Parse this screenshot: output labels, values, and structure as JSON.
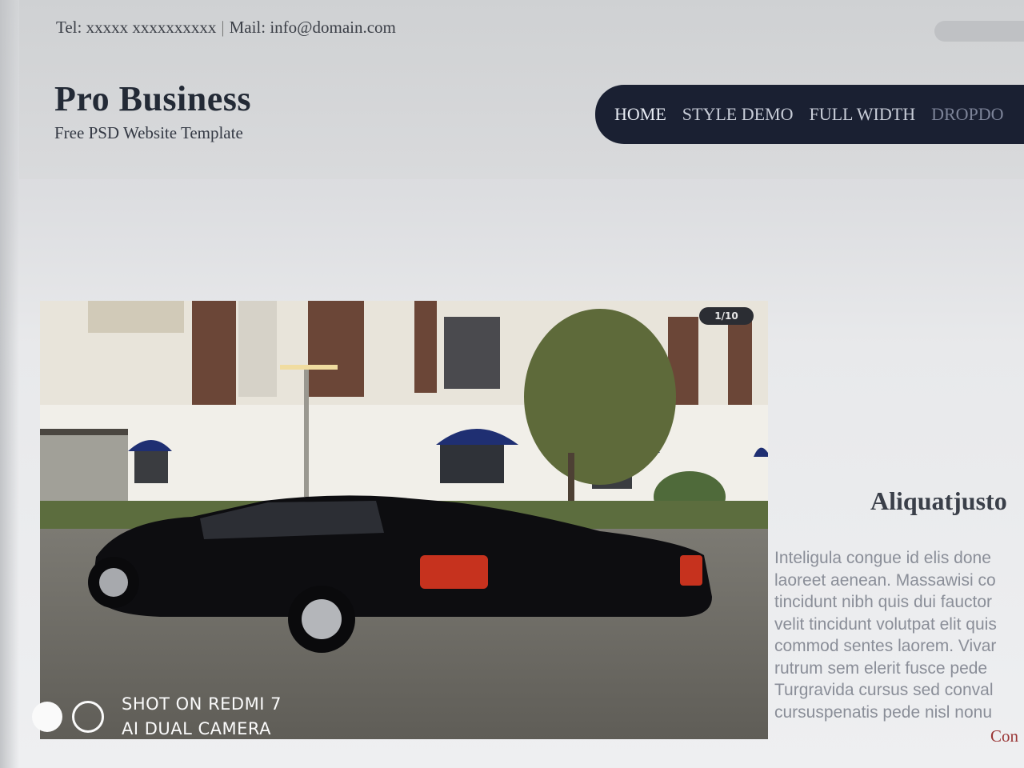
{
  "topbar": {
    "contact_tel": "Tel: xxxxx xxxxxxxxxx",
    "separator": "|",
    "contact_mail": "Mail: info@domain.com"
  },
  "logo": {
    "title": "Pro Business",
    "subtitle": "Free PSD Website Template"
  },
  "nav": {
    "items": [
      {
        "label": "HOME"
      },
      {
        "label": "STYLE DEMO"
      },
      {
        "label": "FULL WIDTH"
      },
      {
        "label": "DROPDO"
      }
    ]
  },
  "slider": {
    "counter": "1/10"
  },
  "side": {
    "title": "Aliquatjusto",
    "lines": [
      "Inteligula congue id elis done",
      "laoreet aenean. Massawisi co",
      "tincidunt nibh quis dui fauctor",
      "velit tincidunt volutpat elit quis",
      "commod sentes laorem. Vivar",
      "rutrum sem elerit fusce pede",
      "Turgravida cursus sed conval",
      "cursuspenatis pede nisl nonu"
    ],
    "continue": "Con"
  },
  "watermark": {
    "line1": "SHOT ON REDMI 7",
    "line2": "AI DUAL CAMERA"
  },
  "colors": {
    "nav_bg": "#1a2032",
    "continue_link": "#9a3636"
  }
}
